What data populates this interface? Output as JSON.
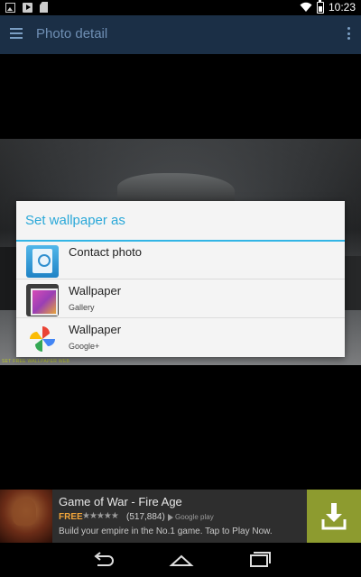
{
  "status_bar": {
    "time": "10:23",
    "icons": [
      "photo-icon",
      "youtube-icon",
      "sd-card-icon",
      "wifi-icon",
      "battery-charging-icon"
    ]
  },
  "action_bar": {
    "title": "Photo detail",
    "menu_icon": "hamburger-icon",
    "overflow_icon": "overflow-menu-icon"
  },
  "photo": {
    "watermark": "SET FREE WALLPAPER WEB"
  },
  "dialog": {
    "title": "Set wallpaper as",
    "options": [
      {
        "label": "Contact photo",
        "sub": "",
        "icon": "contacts-icon"
      },
      {
        "label": "Wallpaper",
        "sub": "Gallery",
        "icon": "gallery-icon"
      },
      {
        "label": "Wallpaper",
        "sub": "Google+",
        "icon": "google-photos-icon"
      }
    ]
  },
  "ad": {
    "title": "Game of War - Fire Age",
    "price": "FREE",
    "stars": "★★★★★",
    "rating": 4.5,
    "review_count": "(517,884)",
    "store": "Google play",
    "description": "Build your empire in the No.1 game. Tap to Play Now.",
    "accent": "#8d9b2f"
  },
  "nav_bar": {
    "icons": [
      "back-icon",
      "home-icon",
      "recent-apps-icon"
    ]
  }
}
